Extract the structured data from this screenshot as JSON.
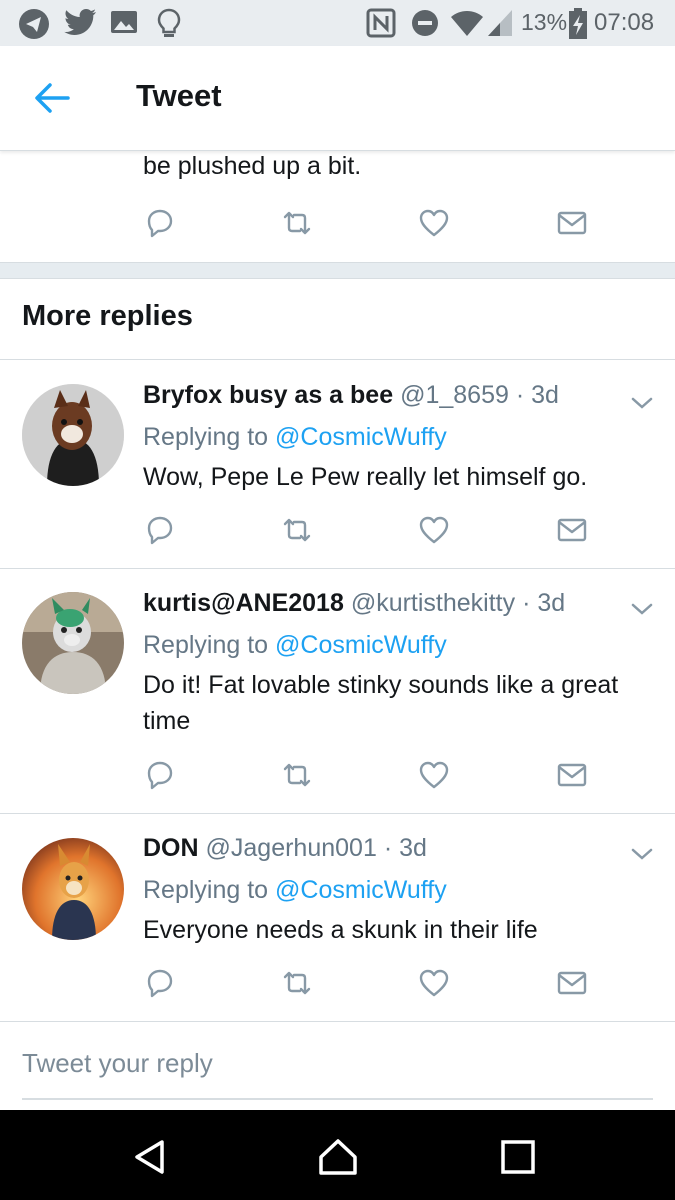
{
  "status_bar": {
    "battery": "13%",
    "time": "07:08",
    "icons": [
      "telegram-icon",
      "twitter-icon",
      "gallery-icon",
      "lightbulb-icon",
      "nfc-icon",
      "do-not-disturb-icon",
      "wifi-icon",
      "signal-icon",
      "battery-charging-icon"
    ]
  },
  "header": {
    "title": "Tweet",
    "back_icon": "back-arrow-icon"
  },
  "previous_tweet": {
    "text_tail": "be plushed up a bit."
  },
  "section": {
    "title": "More replies"
  },
  "replies": [
    {
      "name": "Bryfox busy as a bee",
      "handle": "@1_8659",
      "time": "· 3d",
      "replying_prefix": "Replying to",
      "replying_to": "@CosmicWuffy",
      "text": "Wow, Pepe Le Pew really let himself go."
    },
    {
      "name": "kurtis@ANE2018",
      "handle": "@kurtisthekitty",
      "time": "· 3d",
      "replying_prefix": "Replying to",
      "replying_to": "@CosmicWuffy",
      "text": "Do it! Fat lovable stinky sounds like a great time"
    },
    {
      "name": "DON",
      "handle": "@Jagerhun001",
      "time": "· 3d",
      "replying_prefix": "Replying to",
      "replying_to": "@CosmicWuffy",
      "text": "Everyone needs a skunk in their life"
    }
  ],
  "compose": {
    "placeholder": "Tweet your reply"
  },
  "colors": {
    "accent": "#1da1f2",
    "secondary_text": "#657786",
    "icon_gray": "#8899a6"
  }
}
